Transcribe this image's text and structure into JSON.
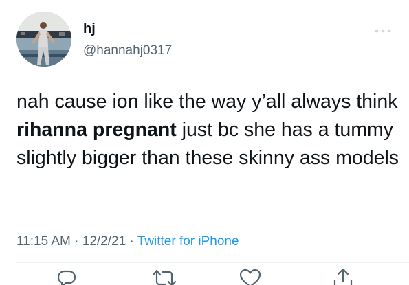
{
  "author": {
    "display_name": "hj",
    "handle": "@hannahj0317",
    "avatar_icon": "user-avatar"
  },
  "tweet": {
    "text_before": "nah cause ion like the way y’all always think ",
    "text_bold": "rihanna pregnant",
    "text_after": " just bc she has a tummy slightly bigger than these skinny ass models"
  },
  "meta": {
    "time": "11:15 AM",
    "separator1": " · ",
    "date": "12/2/21",
    "separator2": " · ",
    "source": "Twitter for iPhone"
  },
  "actions": [
    "reply-icon",
    "retweet-icon",
    "like-icon",
    "share-icon"
  ],
  "colors": {
    "text": "#0f1419",
    "secondary": "#536471",
    "link": "#1d9bf0"
  }
}
